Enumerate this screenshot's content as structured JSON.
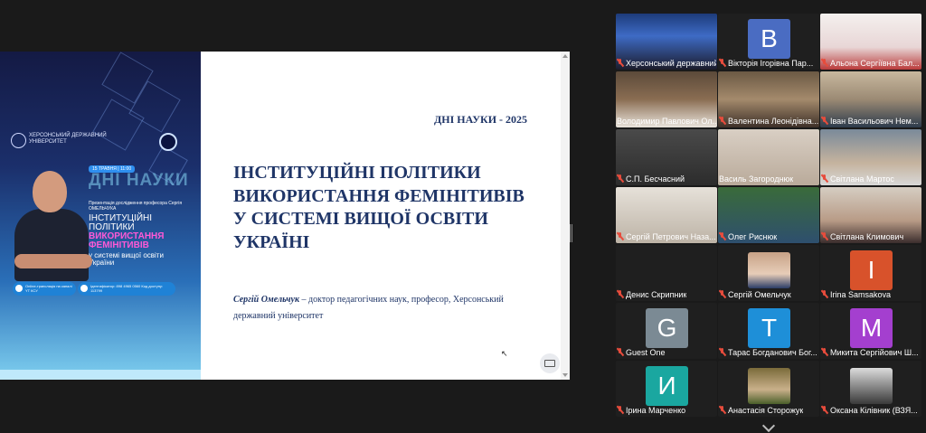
{
  "slide": {
    "poster": {
      "university": "ХЕРСОНСЬКИЙ ДЕРЖАВНИЙ УНІВЕРСИТЕТ",
      "date_badge": "15 ТРАВНЯ | 11:00",
      "big_text": "ДНІ НАУКИ",
      "presentation_line": "Презентація дослідження професора Сергія ОМЕЛЬЧУКА",
      "title_line1": "ІНСТИТУЦІЙНІ ПОЛІТИКИ",
      "title_line2": "ВИКОРИСТАННЯ",
      "title_line3": "ФЕМІНІТИВІВ",
      "title_line4": "у системі вищої освіти",
      "title_line5": "України",
      "pill_left": "Online-трансляція на каналі YT КСУ",
      "pill_right": "Ідентифікатор: 898 4965 0560 Код доступу: 113799"
    },
    "header": "ДНІ НАУКИ - 2025",
    "title": "ІНСТИТУЦІЙНІ ПОЛІТИКИ ВИКОРИСТАННЯ ФЕМІНІТИВІВ У СИСТЕМІ ВИЩОЇ ОСВІТИ УКРАЇНІ",
    "author_name": "Сергій Омельчук",
    "author_desc": " – доктор педагогічних наук, професор, Херсонський державний університет"
  },
  "participants": [
    {
      "name": "Херсонський державний ...",
      "type": "video",
      "muted": true
    },
    {
      "name": "Вікторія Ігорівна Пар...",
      "type": "avatar",
      "letter": "В",
      "color": "#4a6cc2",
      "muted": true
    },
    {
      "name": "Альона Сергіївна Бал...",
      "type": "video",
      "muted": true
    },
    {
      "name": "Володимир Павлович Ол...",
      "type": "video",
      "muted": false
    },
    {
      "name": "Валентина Леонідівна...",
      "type": "video",
      "muted": true
    },
    {
      "name": "Іван Васильович Нем...",
      "type": "video",
      "muted": true
    },
    {
      "name": "С.П. Бесчасний",
      "type": "video",
      "muted": true
    },
    {
      "name": "Василь Загороднюк",
      "type": "video",
      "muted": false,
      "active": true
    },
    {
      "name": "Світлана   Мартос",
      "type": "video",
      "muted": true
    },
    {
      "name": "Сергій Петрович Наза...",
      "type": "video",
      "muted": true
    },
    {
      "name": "Олег Риснюк",
      "type": "video",
      "muted": true
    },
    {
      "name": "Світлана Климович",
      "type": "video",
      "muted": true
    },
    {
      "name": "Денис Скрипник",
      "type": "none",
      "muted": true
    },
    {
      "name": "Сергій Омельчук",
      "type": "photo",
      "muted": true
    },
    {
      "name": "Irina Samsakova",
      "type": "avatar",
      "letter": "I",
      "color": "#d8522b",
      "muted": true
    },
    {
      "name": "Guest One",
      "type": "avatar",
      "letter": "G",
      "color": "#7b8a94",
      "muted": true
    },
    {
      "name": "Тарас Богданович Бог...",
      "type": "avatar",
      "letter": "T",
      "color": "#1e8fd8",
      "muted": true
    },
    {
      "name": "Микита Сергійович Ш...",
      "type": "avatar",
      "letter": "M",
      "color": "#a43fcf",
      "muted": true
    },
    {
      "name": "Ірина Марченко",
      "type": "avatar",
      "letter": "И",
      "color": "#1aa7a0",
      "muted": true
    },
    {
      "name": "Анастасія Сторожук",
      "type": "photo",
      "muted": true
    },
    {
      "name": "Оксана Кілівник (ВЗЯ...",
      "type": "photo",
      "muted": true
    }
  ]
}
